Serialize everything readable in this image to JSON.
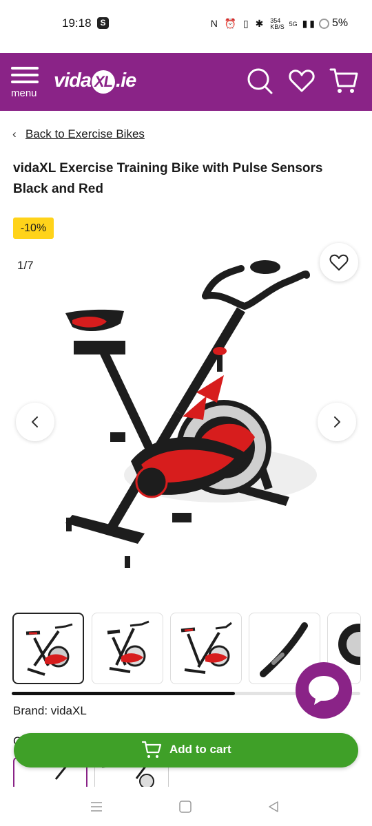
{
  "status_bar": {
    "time": "19:18",
    "app_badge": "S",
    "speed_top": "354",
    "speed_bottom": "KB/S",
    "network": "5G",
    "battery": "5%"
  },
  "header": {
    "menu_label": "menu",
    "logo_prefix": "vida",
    "logo_mark": "XL",
    "logo_suffix": ".ie",
    "brand_color": "#8a2387",
    "icons": [
      "search-icon",
      "heart-icon",
      "cart-icon"
    ]
  },
  "breadcrumb": {
    "back_label": "Back to Exercise Bikes"
  },
  "product": {
    "title": "vidaXL Exercise Training Bike with Pulse Sensors Black and Red",
    "discount_badge": "-10%",
    "brand_line": "Brand: vidaXL",
    "partial_label": "C"
  },
  "gallery": {
    "counter": "1/7",
    "current_index": 1,
    "total": 7,
    "scroll_fraction": 0.64
  },
  "actions": {
    "add_to_cart_label": "Add to cart",
    "cart_button_color": "#3fa028"
  }
}
